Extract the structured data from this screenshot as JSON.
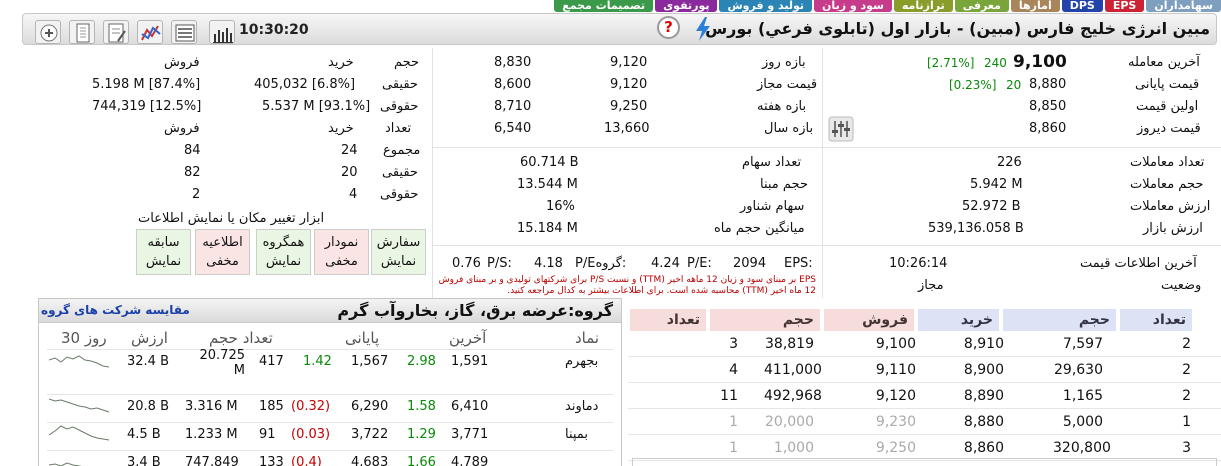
{
  "tabs": [
    {
      "label": "سهامداران",
      "color": "#7f9fbf"
    },
    {
      "label": "EPS",
      "color": "#cc2233"
    },
    {
      "label": "DPS",
      "color": "#2244aa"
    },
    {
      "label": "امارها",
      "color": "#a8855a"
    },
    {
      "label": "معرفی",
      "color": "#7aa53a"
    },
    {
      "label": "ترازنامه",
      "color": "#8a9c2a"
    },
    {
      "label": "سود و زیان",
      "color": "#c63b8a"
    },
    {
      "label": "تولید و فروش",
      "color": "#2a85b5"
    },
    {
      "label": "پورتفوی",
      "color": "#8a2a9c"
    },
    {
      "label": "تصمیمات مجمع",
      "color": "#3a9a4a"
    }
  ],
  "title": "مبین انرژی خلیج فارس (مبین) - بازار اول (تابلوی فرعي) بورس",
  "clock": "10:30:20",
  "help_glyph": "?",
  "toolbar_icons": [
    "bar-chart-icon",
    "list-icon",
    "network-chart-icon",
    "edit-note-icon",
    "document-icon",
    "add-icon"
  ],
  "price": {
    "last_label": "آخرین معامله",
    "last_value": "9,100",
    "last_change": "240",
    "last_percent": "[2.71%]",
    "close_label": "قیمت پایانی",
    "close_value": "8,880",
    "close_change": "20",
    "close_percent": "[0.23%]",
    "first_label": "اولین قیمت",
    "first_value": "8,850",
    "yesterday_label": "قیمت دیروز",
    "yesterday_value": "8,860"
  },
  "ranges": {
    "day_label": "بازه روز",
    "day_high": "9,120",
    "day_low": "8,830",
    "allowed_label": "قیمت مجاز",
    "allowed_high": "9,120",
    "allowed_low": "8,600",
    "week_label": "بازه هفته",
    "week_high": "9,250",
    "week_low": "8,710",
    "year_label": "بازه سال",
    "year_high": "13,660",
    "year_low": "6,540"
  },
  "investors": {
    "h_volume": "حجم",
    "h_buy": "خرید",
    "h_sell": "فروش",
    "real_label": "حقیقی",
    "real_buy": "405,032 [6.8%]",
    "real_sell": "5.198 M [87.4%]",
    "legal_label": "حقوقی",
    "legal_buy": "5.537 M [93.1%]",
    "legal_sell": "744,319 [12.5%]",
    "h_count": "تعداد",
    "h_buy2": "خرید",
    "h_sell2": "فروش",
    "total_label": "مجموع",
    "total_buy": "24",
    "total_sell": "84",
    "real2_label": "حقیقی",
    "real2_buy": "20",
    "real2_sell": "82",
    "legal2_label": "حقوقی",
    "legal2_buy": "4",
    "legal2_sell": "2"
  },
  "stats_left": {
    "trades_label": "تعداد معاملات",
    "trades_value": "226",
    "volume_label": "حجم معاملات",
    "volume_value": "5.942 M",
    "value_label": "ارزش معاملات",
    "value_value": "52.972 B",
    "mcap_label": "ارزش بازار",
    "mcap_value": "539,136.058 B"
  },
  "stats_mid": {
    "shares_label": "تعداد سهام",
    "shares_value": "60.714 B",
    "base_label": "حجم مبنا",
    "base_value": "13.544 M",
    "float_label": "سهام شناور",
    "float_value": "16%",
    "avgvol_label": "میانگین حجم ماه",
    "avgvol_value": "15.184 M"
  },
  "ratios": {
    "eps_label": "EPS:",
    "eps_value": "2094",
    "pe_label": "P/E:",
    "pe_value": "4.24",
    "gpe_label": "P/Eگروه:",
    "gpe_value": "4.18",
    "ps_label": "P/S:",
    "ps_value": "0.76",
    "note": "EPS بر مبنای سود و زیان 12 ماهه اخیر (TTM) و نسبت P/S برای شرکتهای تولیدی و بر مبنای فروش 12 ماه اخیر (TTM) محاسبه شده است. برای اطلاعات بیشتر به کدال مراجعه کنید."
  },
  "info": {
    "last_update_label": "آخرین اطلاعات قیمت",
    "last_update_value": "10:26:14",
    "status_label": "وضعیت",
    "status_value": "مجاز"
  },
  "tools": {
    "caption": "ابزار تغییر مکان یا نمایش اطلاعات",
    "buttons": [
      {
        "line1": "سفارش",
        "line2": "نمایش",
        "kind": "green"
      },
      {
        "line1": "نمودار",
        "line2": "مخفی",
        "kind": "red"
      },
      {
        "line1": "همگروه",
        "line2": "نمایش",
        "kind": "green"
      },
      {
        "line1": "اطلاعیه",
        "line2": "مخفی",
        "kind": "red"
      },
      {
        "line1": "سابقه",
        "line2": "نمایش",
        "kind": "green"
      }
    ]
  },
  "group": {
    "title": "گروه:عرضه برق، گاز، بخاروآب گرم",
    "compare_link": "مقایسه شرکت های گروه",
    "headers": {
      "symbol": "نماد",
      "last": "آخرین",
      "close": "پایانی",
      "volume": "تعداد حجم",
      "value": "ارزش",
      "days": "30 روز"
    },
    "rows": [
      {
        "symbol": "بجهرم",
        "last": "1,591",
        "last_chg": "2.98",
        "close": "1,567",
        "close_chg": "1.42",
        "count": "417",
        "volume": "20.725 M",
        "value": "32.4 B"
      },
      {
        "symbol": "دماوند",
        "last": "6,410",
        "last_chg": "1.58",
        "close": "6,290",
        "close_chg": "(0.32)",
        "count": "185",
        "volume": "3.316 M",
        "value": "20.8 B"
      },
      {
        "symbol": "بمپنا",
        "last": "3,771",
        "last_chg": "1.29",
        "close": "3,722",
        "close_chg": "(0.03)",
        "count": "91",
        "volume": "1.233 M",
        "value": "4.5 B"
      },
      {
        "symbol": "",
        "last": "4,789",
        "last_chg": "1.66",
        "close": "4,683",
        "close_chg": "(0.4)",
        "count": "133",
        "volume": "747,849",
        "value": "3.4 B"
      }
    ]
  },
  "orderbook": {
    "headers": {
      "count": "تعداد",
      "volume": "حجم",
      "buy": "خرید",
      "sell": "فروش",
      "volume2": "حجم",
      "count2": "تعداد"
    },
    "rows": [
      {
        "buy_count": "2",
        "buy_volume": "7,597",
        "buy_price": "8,910",
        "sell_price": "9,100",
        "sell_volume": "38,819",
        "sell_count": "3",
        "muted": false
      },
      {
        "buy_count": "2",
        "buy_volume": "29,630",
        "buy_price": "8,900",
        "sell_price": "9,110",
        "sell_volume": "411,000",
        "sell_count": "4",
        "muted": false
      },
      {
        "buy_count": "2",
        "buy_volume": "1,165",
        "buy_price": "8,890",
        "sell_price": "9,120",
        "sell_volume": "492,968",
        "sell_count": "11",
        "muted": false
      },
      {
        "buy_count": "1",
        "buy_volume": "5,000",
        "buy_price": "8,880",
        "sell_price": "9,230",
        "sell_volume": "20,000",
        "sell_count": "1",
        "muted": true
      },
      {
        "buy_count": "3",
        "buy_volume": "320,800",
        "buy_price": "8,860",
        "sell_price": "9,250",
        "sell_volume": "1,000",
        "sell_count": "1",
        "muted": true
      }
    ]
  }
}
